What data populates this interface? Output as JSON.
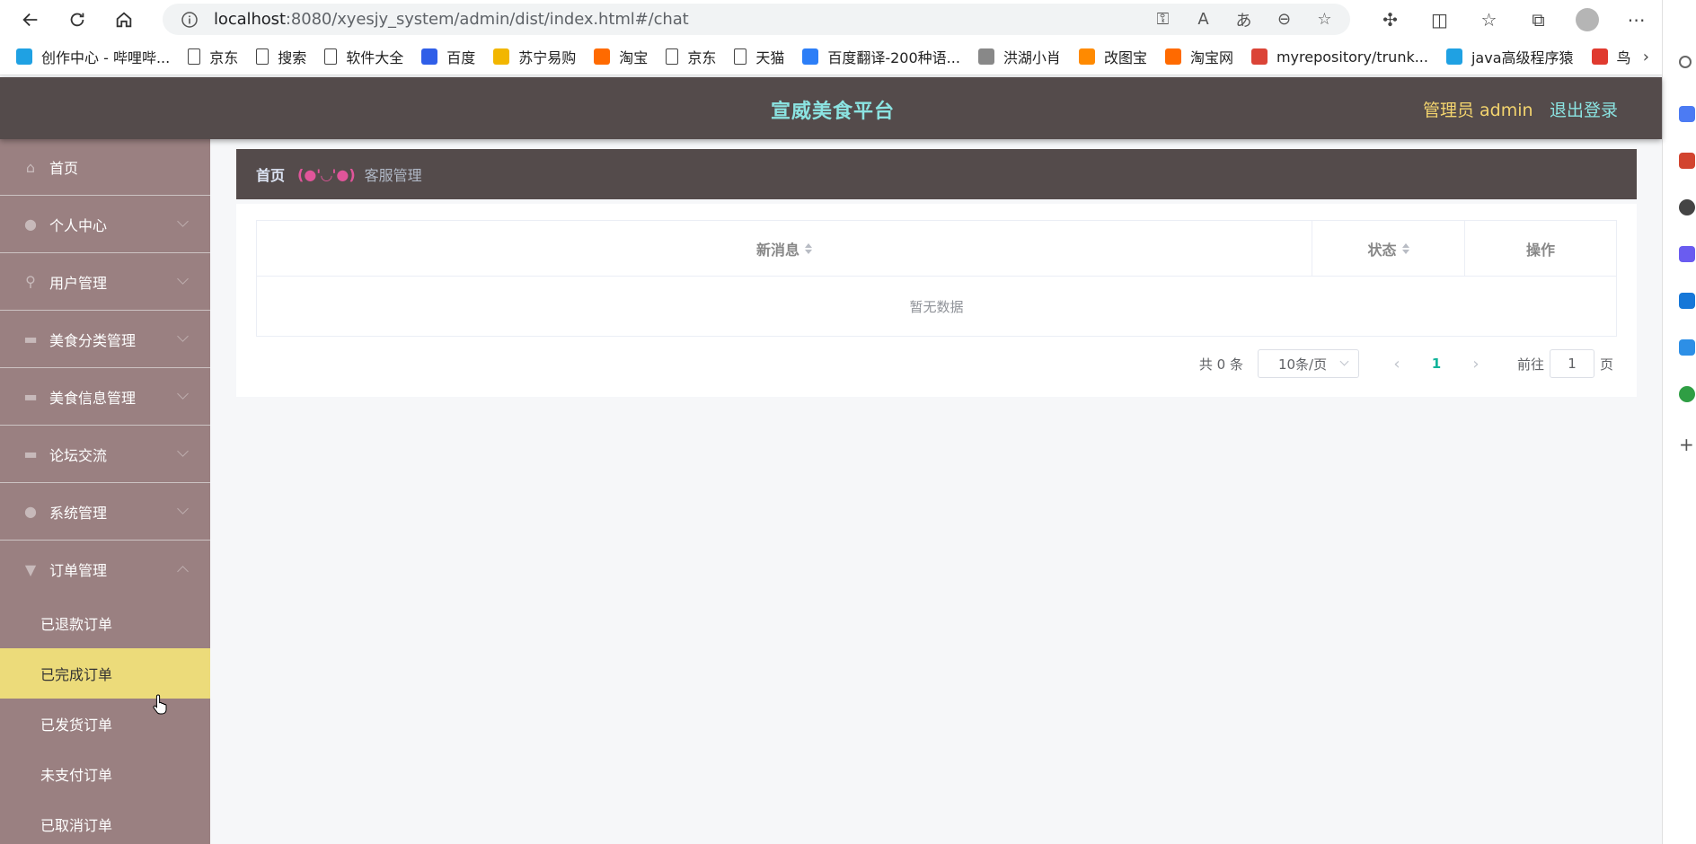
{
  "browser": {
    "url_host": "localhost",
    "url_path": ":8080/xyesjy_system/admin/dist/index.html#/chat",
    "bookmarks": [
      {
        "label": "创作中心 - 哔哩哔...",
        "icon": "bilibili-icon",
        "color": "#1fa1e3"
      },
      {
        "label": "京东",
        "icon": "page-icon",
        "color": ""
      },
      {
        "label": "搜索",
        "icon": "page-icon",
        "color": ""
      },
      {
        "label": "软件大全",
        "icon": "page-icon",
        "color": ""
      },
      {
        "label": "百度",
        "icon": "baidu-icon",
        "color": "#2f5ee8"
      },
      {
        "label": "苏宁易购",
        "icon": "suning-icon",
        "color": "#f2b600"
      },
      {
        "label": "淘宝",
        "icon": "taobao-icon",
        "color": "#ff6a00"
      },
      {
        "label": "京东",
        "icon": "page-icon",
        "color": ""
      },
      {
        "label": "天猫",
        "icon": "page-icon",
        "color": ""
      },
      {
        "label": "百度翻译-200种语...",
        "icon": "translate-icon",
        "color": "#2c7ef7"
      },
      {
        "label": "洪湖小肖",
        "icon": "bird-icon",
        "color": "#888"
      },
      {
        "label": "改图宝",
        "icon": "gaitubao-icon",
        "color": "#ff8a00"
      },
      {
        "label": "淘宝网",
        "icon": "taobao-icon",
        "color": "#ff6a00"
      },
      {
        "label": "myrepository/trunk...",
        "icon": "chrome-icon",
        "color": "#db4437"
      },
      {
        "label": "java高级程序猿",
        "icon": "bilibili-icon",
        "color": "#1fa1e3"
      },
      {
        "label": "鸟",
        "icon": "bird-icon",
        "color": "#e03a2f"
      }
    ]
  },
  "header": {
    "title": "宣威美食平台",
    "admin_label": "管理员 admin",
    "logout_label": "退出登录"
  },
  "sidebar": {
    "items": [
      {
        "label": "首页",
        "icon": "home-icon",
        "has_chevron": false
      },
      {
        "label": "个人中心",
        "icon": "user-icon",
        "has_chevron": true
      },
      {
        "label": "用户管理",
        "icon": "pin-icon",
        "has_chevron": true
      },
      {
        "label": "美食分类管理",
        "icon": "category-icon",
        "has_chevron": true
      },
      {
        "label": "美食信息管理",
        "icon": "info-icon",
        "has_chevron": true
      },
      {
        "label": "论坛交流",
        "icon": "forum-icon",
        "has_chevron": true
      },
      {
        "label": "系统管理",
        "icon": "user-icon",
        "has_chevron": true
      },
      {
        "label": "订单管理",
        "icon": "order-icon",
        "has_chevron": true
      }
    ],
    "sub_items": [
      {
        "label": "已退款订单",
        "active": false
      },
      {
        "label": "已完成订单",
        "active": true
      },
      {
        "label": "已发货订单",
        "active": false
      },
      {
        "label": "未支付订单",
        "active": false
      },
      {
        "label": "已取消订单",
        "active": false
      }
    ]
  },
  "breadcrumb": {
    "home": "首页",
    "separator": "(●'◡'●)",
    "current": "客服管理"
  },
  "table": {
    "columns": [
      "新消息",
      "状态",
      "操作"
    ],
    "empty_text": "暂无数据"
  },
  "pagination": {
    "total": "共 0 条",
    "page_size": "10条/页",
    "current_page": "1",
    "goto_label": "前往",
    "goto_value": "1",
    "page_suffix": "页"
  },
  "colors": {
    "header_bg": "#544b4b",
    "sidebar_bg": "#9a8081",
    "active_bg": "#ecdb7a",
    "title_color": "#8be4e2",
    "admin_color": "#f3d46e",
    "accent_page": "#11b39a"
  }
}
